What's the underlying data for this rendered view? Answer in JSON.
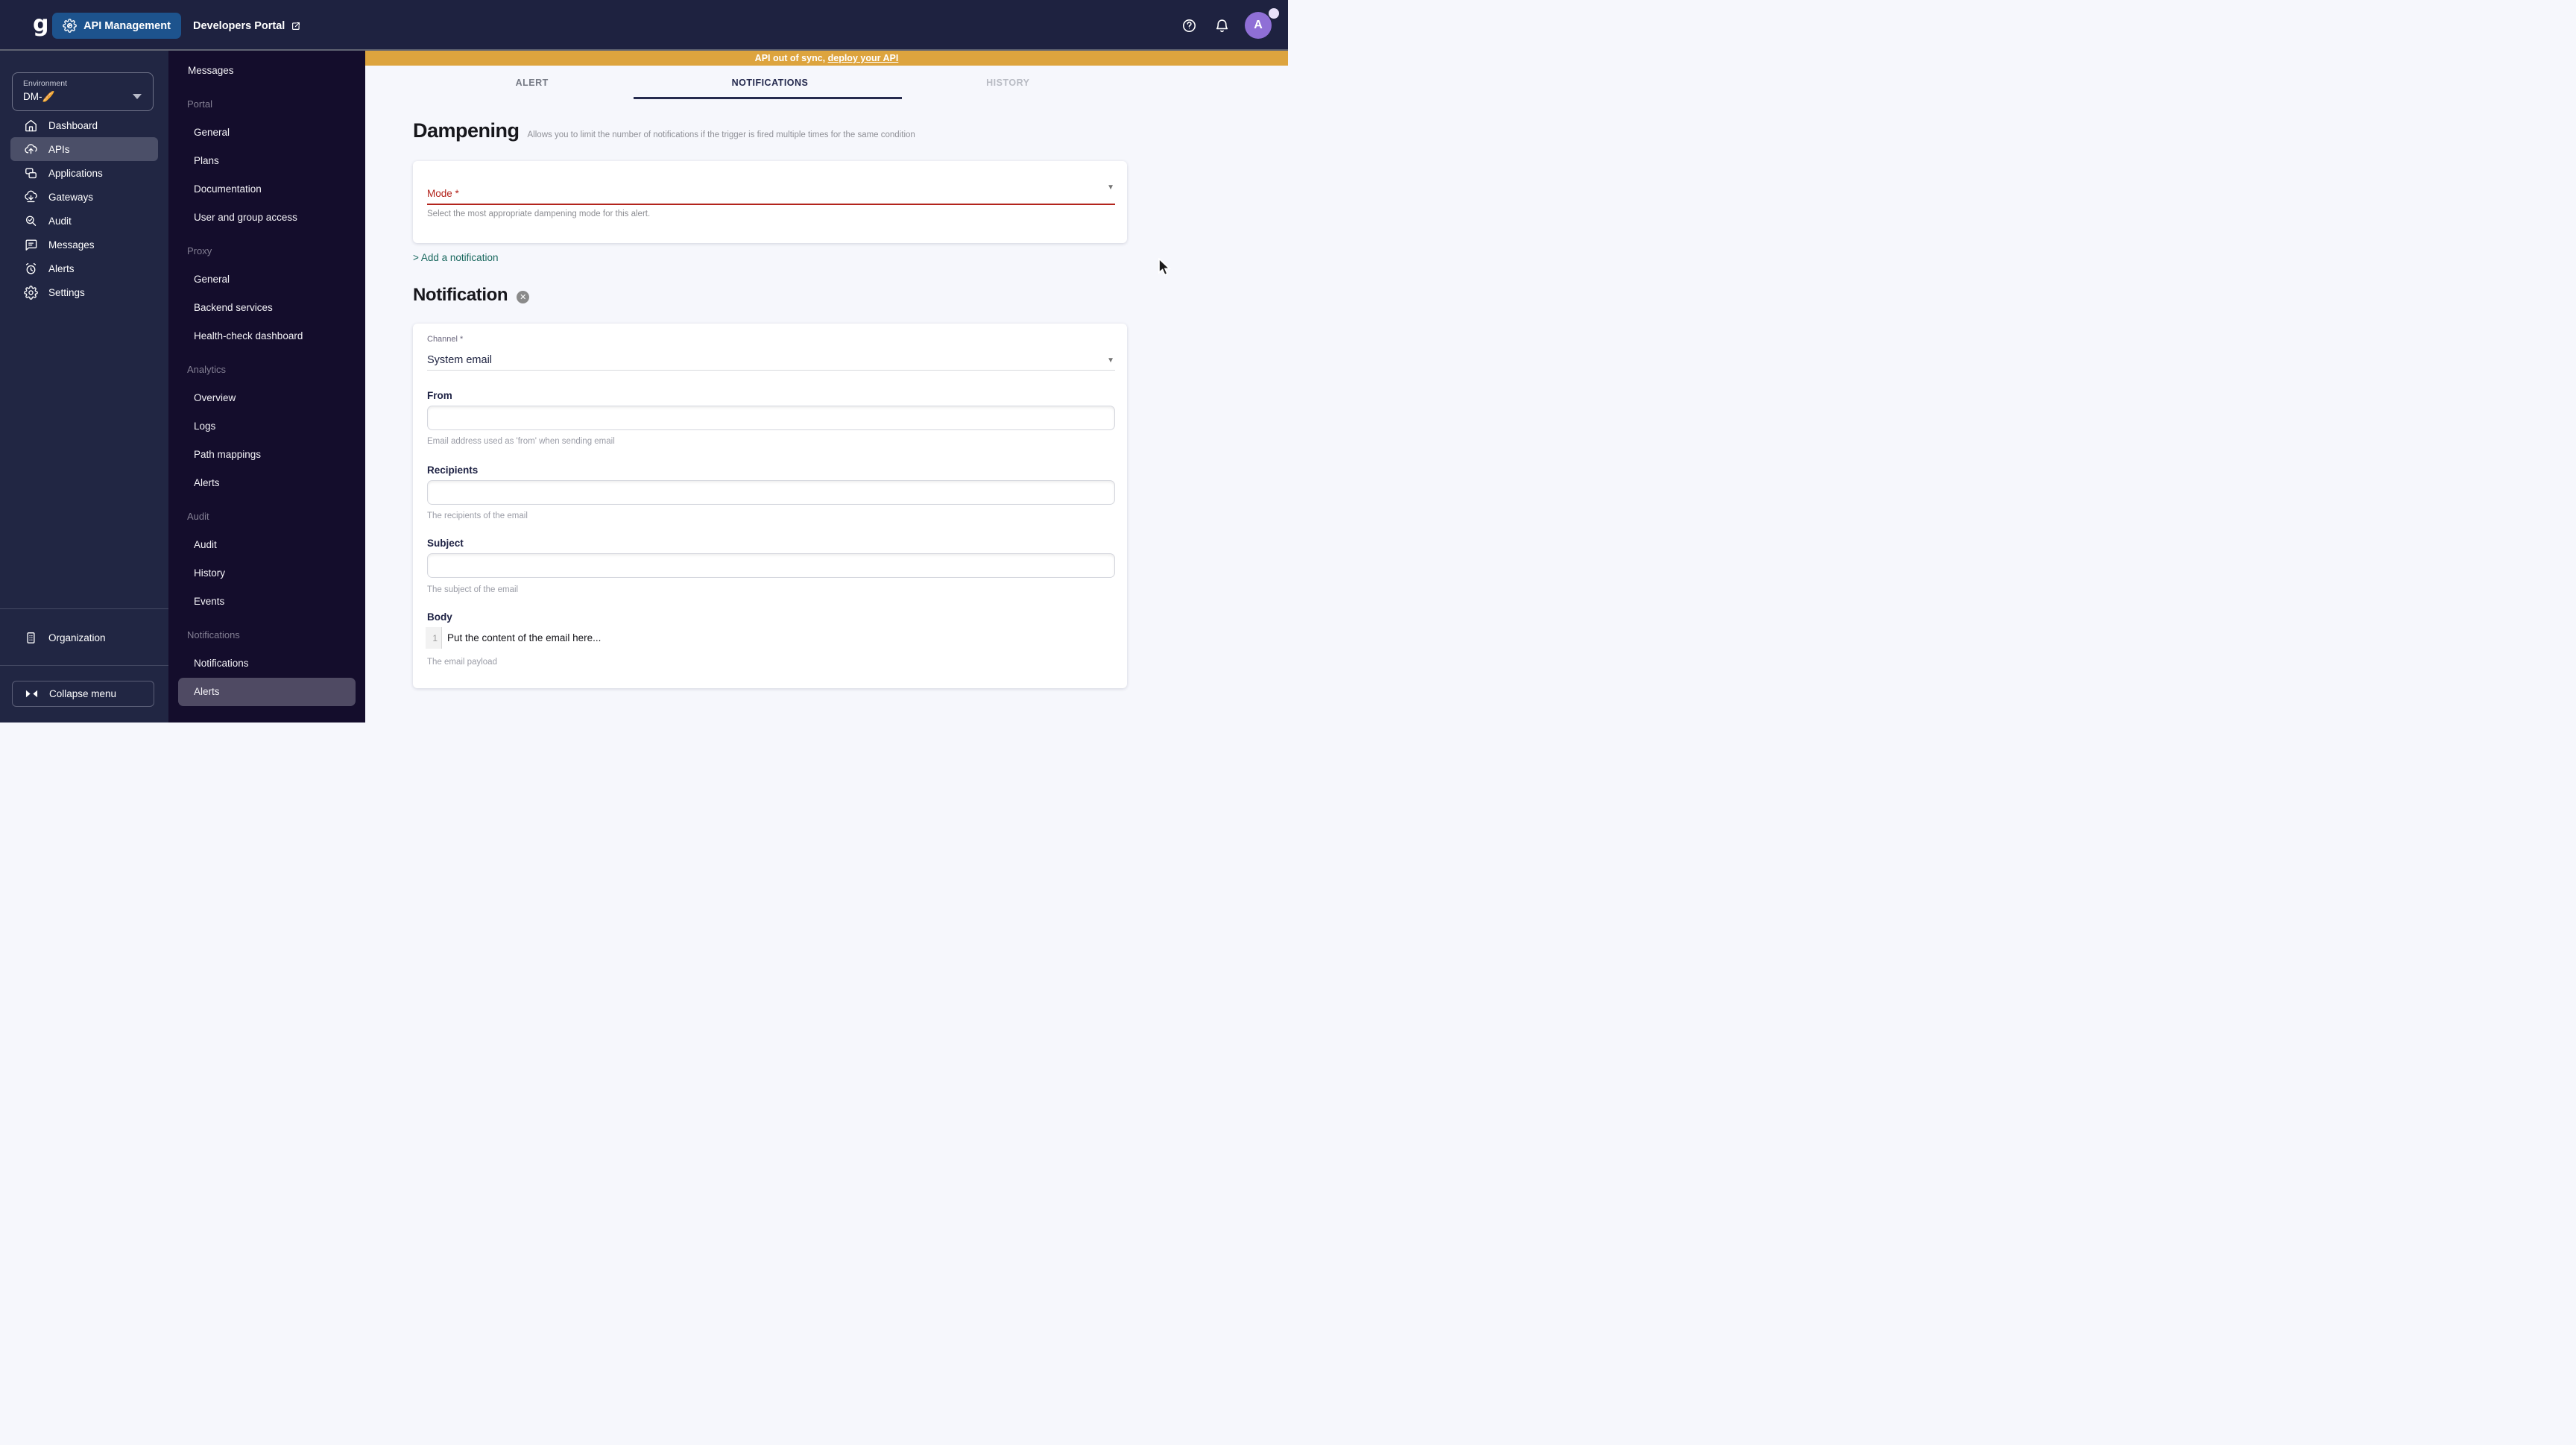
{
  "topbar": {
    "logo": "g",
    "app_button": "API Management",
    "portal_link": "Developers Portal",
    "avatar_initial": "A"
  },
  "environment": {
    "label": "Environment",
    "value": "DM-🥖"
  },
  "sidebar": {
    "items": [
      {
        "label": "Dashboard"
      },
      {
        "label": "APIs"
      },
      {
        "label": "Applications"
      },
      {
        "label": "Gateways"
      },
      {
        "label": "Audit"
      },
      {
        "label": "Messages"
      },
      {
        "label": "Alerts"
      },
      {
        "label": "Settings"
      }
    ],
    "organization": "Organization",
    "collapse": "Collapse menu"
  },
  "submenu": {
    "top_item": "Messages",
    "sections": [
      {
        "header": "Portal",
        "items": [
          "General",
          "Plans",
          "Documentation",
          "User and group access"
        ]
      },
      {
        "header": "Proxy",
        "items": [
          "General",
          "Backend services",
          "Health-check dashboard"
        ]
      },
      {
        "header": "Analytics",
        "items": [
          "Overview",
          "Logs",
          "Path mappings",
          "Alerts"
        ]
      },
      {
        "header": "Audit",
        "items": [
          "Audit",
          "History",
          "Events"
        ]
      },
      {
        "header": "Notifications",
        "items": [
          "Notifications",
          "Alerts"
        ]
      }
    ]
  },
  "banner": {
    "prefix": "API out of sync, ",
    "link": "deploy your API"
  },
  "tabs": {
    "alert": "ALERT",
    "notifications": "NOTIFICATIONS",
    "history": "HISTORY"
  },
  "dampening": {
    "title": "Dampening",
    "description": "Allows you to limit the number of notifications if the trigger is fired multiple times for the same condition"
  },
  "mode": {
    "label": "Mode *",
    "hint": "Select the most appropriate dampening mode for this alert."
  },
  "add_link": "> Add a notification",
  "notification": {
    "title": "Notification",
    "close": "✕",
    "channel_label": "Channel *",
    "channel_value": "System email",
    "from_label": "From",
    "from_hint": "Email address used as 'from' when sending email",
    "recipients_label": "Recipients",
    "recipients_hint": "The recipients of the email",
    "subject_label": "Subject",
    "subject_hint": "The subject of the email",
    "body_label": "Body",
    "body_line": "1",
    "body_text": "Put the content of the email here...",
    "body_hint": "The email payload"
  },
  "colors": {
    "topbar_bg": "#1e2240",
    "sidebar_bg": "#212643",
    "submenu_bg": "#140d2c",
    "banner_bg": "#dda43e",
    "accent_blue": "#1d538d",
    "error_red": "#b3241c",
    "link_teal": "#19685e",
    "avatar_purple": "#8f6fd6"
  }
}
